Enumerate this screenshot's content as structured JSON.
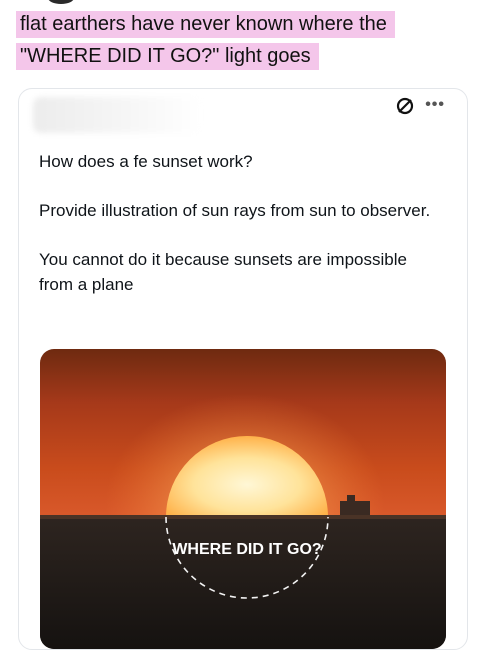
{
  "caption": {
    "line1": "flat earthers have never known where the",
    "line2": "\"WHERE DID IT GO?\" light goes"
  },
  "post": {
    "icons": {
      "block": "no-entry-icon",
      "more": "more-options-icon"
    },
    "more_label": "•••",
    "paragraphs": [
      "How does a fe sunset work?",
      "Provide illustration of sun rays from sun to observer.",
      "You cannot do it because sunsets are impossible from a plane"
    ]
  },
  "image": {
    "overlay_text": "WHERE DID IT GO?"
  }
}
